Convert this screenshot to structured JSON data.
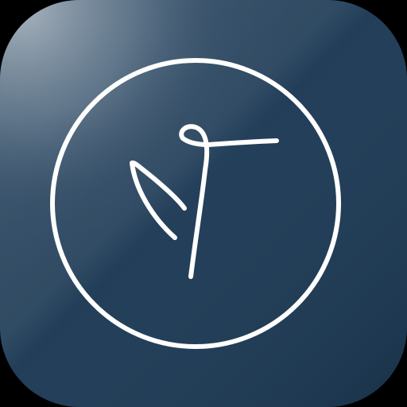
{
  "app_icon": {
    "icon": "app-logo-icon",
    "colors": {
      "background_base": "#1d3851",
      "background_highlight": "#8a9aa8",
      "stroke": "#ffffff",
      "outside": "#000000"
    }
  }
}
